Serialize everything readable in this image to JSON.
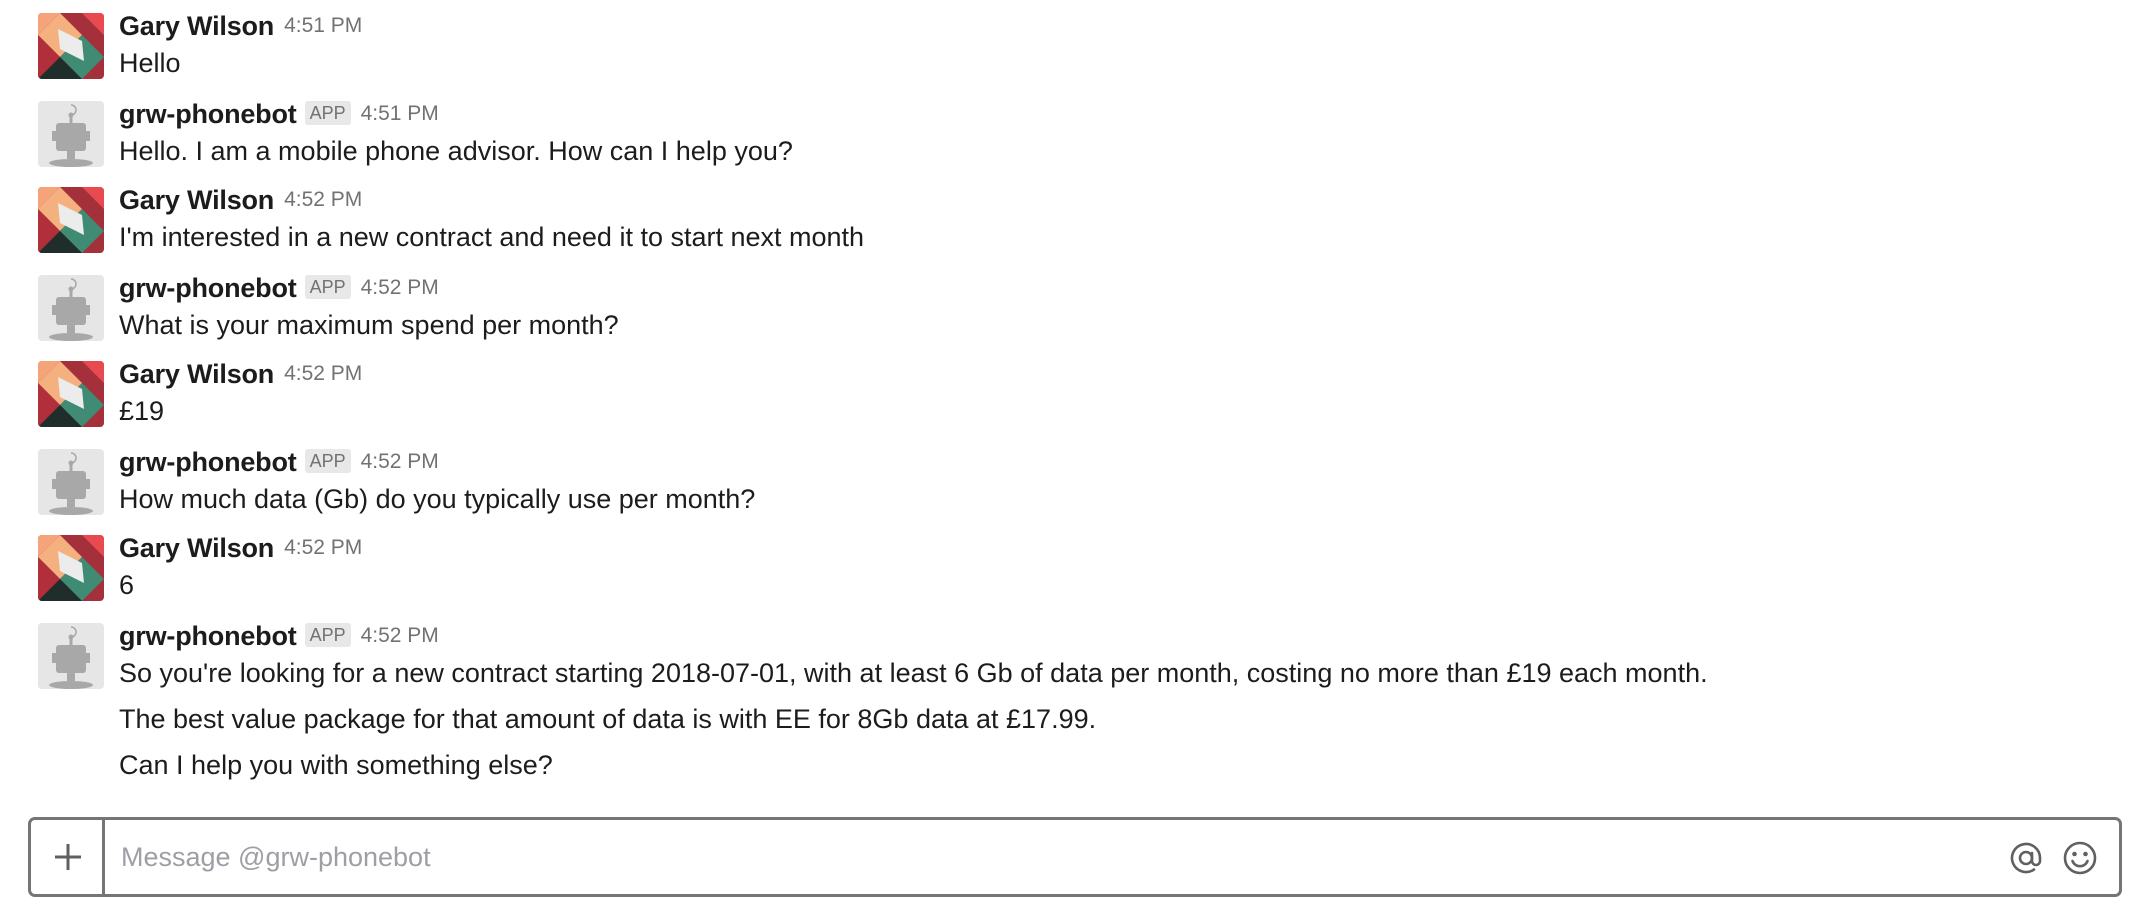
{
  "conversation": {
    "messages": [
      {
        "author": "Gary Wilson",
        "is_app": false,
        "time": "4:51 PM",
        "lines": [
          "Hello"
        ]
      },
      {
        "author": "grw-phonebot",
        "is_app": true,
        "app_badge": "APP",
        "time": "4:51 PM",
        "lines": [
          "Hello. I am a mobile phone advisor. How can I help you?"
        ]
      },
      {
        "author": "Gary Wilson",
        "is_app": false,
        "time": "4:52 PM",
        "lines": [
          "I'm interested in a new contract and need it to start next month"
        ]
      },
      {
        "author": "grw-phonebot",
        "is_app": true,
        "app_badge": "APP",
        "time": "4:52 PM",
        "lines": [
          "What is your maximum spend per month?"
        ]
      },
      {
        "author": "Gary Wilson",
        "is_app": false,
        "time": "4:52 PM",
        "lines": [
          "£19"
        ]
      },
      {
        "author": "grw-phonebot",
        "is_app": true,
        "app_badge": "APP",
        "time": "4:52 PM",
        "lines": [
          "How much data (Gb) do you typically use per month?"
        ]
      },
      {
        "author": "Gary Wilson",
        "is_app": false,
        "time": "4:52 PM",
        "lines": [
          "6"
        ]
      },
      {
        "author": "grw-phonebot",
        "is_app": true,
        "app_badge": "APP",
        "time": "4:52 PM",
        "lines": [
          "So you're looking for a new contract starting 2018-07-01, with at least 6 Gb of data per month, costing no more than £19 each month.",
          "The best value package for that amount of data is with EE for 8Gb data at £17.99.",
          "Can I help you with something else?"
        ]
      }
    ]
  },
  "composer": {
    "placeholder": "Message @grw-phonebot",
    "value": "",
    "plus_icon": "plus-icon",
    "at_icon": "at-mention-icon",
    "emoji_icon": "emoji-icon"
  },
  "colors": {
    "text": "#1d1c1d",
    "muted": "#717274",
    "border": "#757575",
    "badge_bg": "#e8e8e8"
  }
}
